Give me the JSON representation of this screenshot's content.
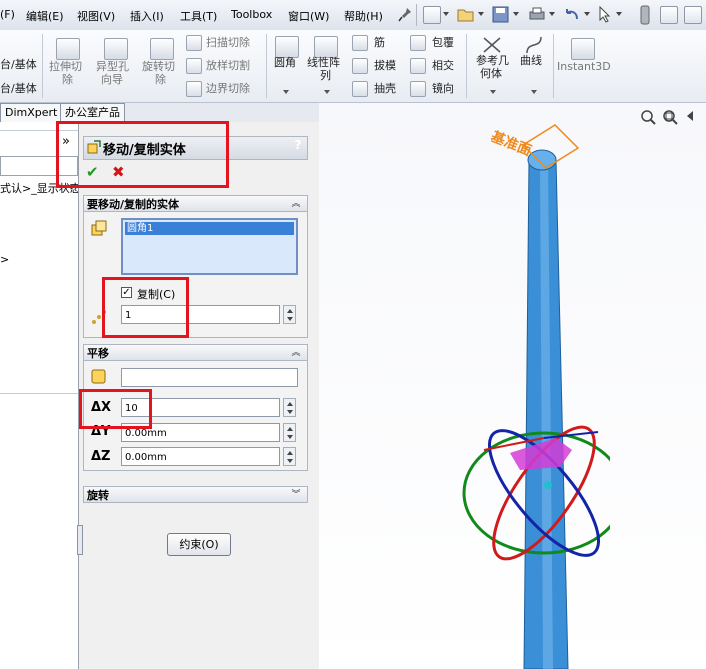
{
  "menu": {
    "file_partial": "(F)",
    "edit": "编辑(E)",
    "view": "视图(V)",
    "insert": "插入(I)",
    "tools": "工具(T)",
    "toolbox": "Toolbox",
    "window": "窗口(W)",
    "help": "帮助(H)"
  },
  "ribbon": {
    "left_cut_1": "台/基体",
    "left_cut_2": "台/基体",
    "extrude_cut_line1": "拉伸切",
    "extrude_cut_line2": "除",
    "hole_wizard_line1": "异型孔",
    "hole_wizard_line2": "向导",
    "revolve_cut_line1": "旋转切",
    "revolve_cut_line2": "除",
    "sweep_cut": "扫描切除",
    "loft_cut": "放样切割",
    "boundary_cut": "边界切除",
    "fillet": "圆角",
    "linear_pattern_line1": "线性阵",
    "linear_pattern_line2": "列",
    "rib": "筋",
    "draft": "拔模",
    "shell": "抽壳",
    "wrap": "包覆",
    "intersect": "相交",
    "mirror": "镜向",
    "ref_geom_line1": "参考几",
    "ref_geom_line2": "何体",
    "curves": "曲线",
    "instant3d": "Instant3D"
  },
  "tabs": {
    "dimxpert": "DimXpert",
    "office": "办公室产品"
  },
  "tree": {
    "row1_partial": "式认>_显示状态",
    "row2_partial": ">"
  },
  "pm": {
    "title": "移动/复制实体",
    "help": "?",
    "ok": "✔",
    "cancel": "✖",
    "bodies_group": "要移动/复制的实体",
    "bodies_list": [
      "圆角1"
    ],
    "copy_label": "复制(C)",
    "copy_checked": true,
    "copies_value": "1",
    "translate_group": "平移",
    "translate_ref_value": "",
    "dx_label": "ΔX",
    "dx_value": "10",
    "dy_label": "ΔY",
    "dy_value": "0.00mm",
    "dz_label": "ΔZ",
    "dz_value": "0.00mm",
    "rotate_group": "旋转",
    "constraints_button": "约束(O)"
  },
  "viewport": {
    "base_label": "基准面",
    "accent": "#f08a1c",
    "body_color": "#3a8fd6",
    "ring_red": "#d11a1a",
    "ring_green": "#118a1c",
    "ring_blue": "#1424a8",
    "preview_color": "#d33cd6"
  }
}
